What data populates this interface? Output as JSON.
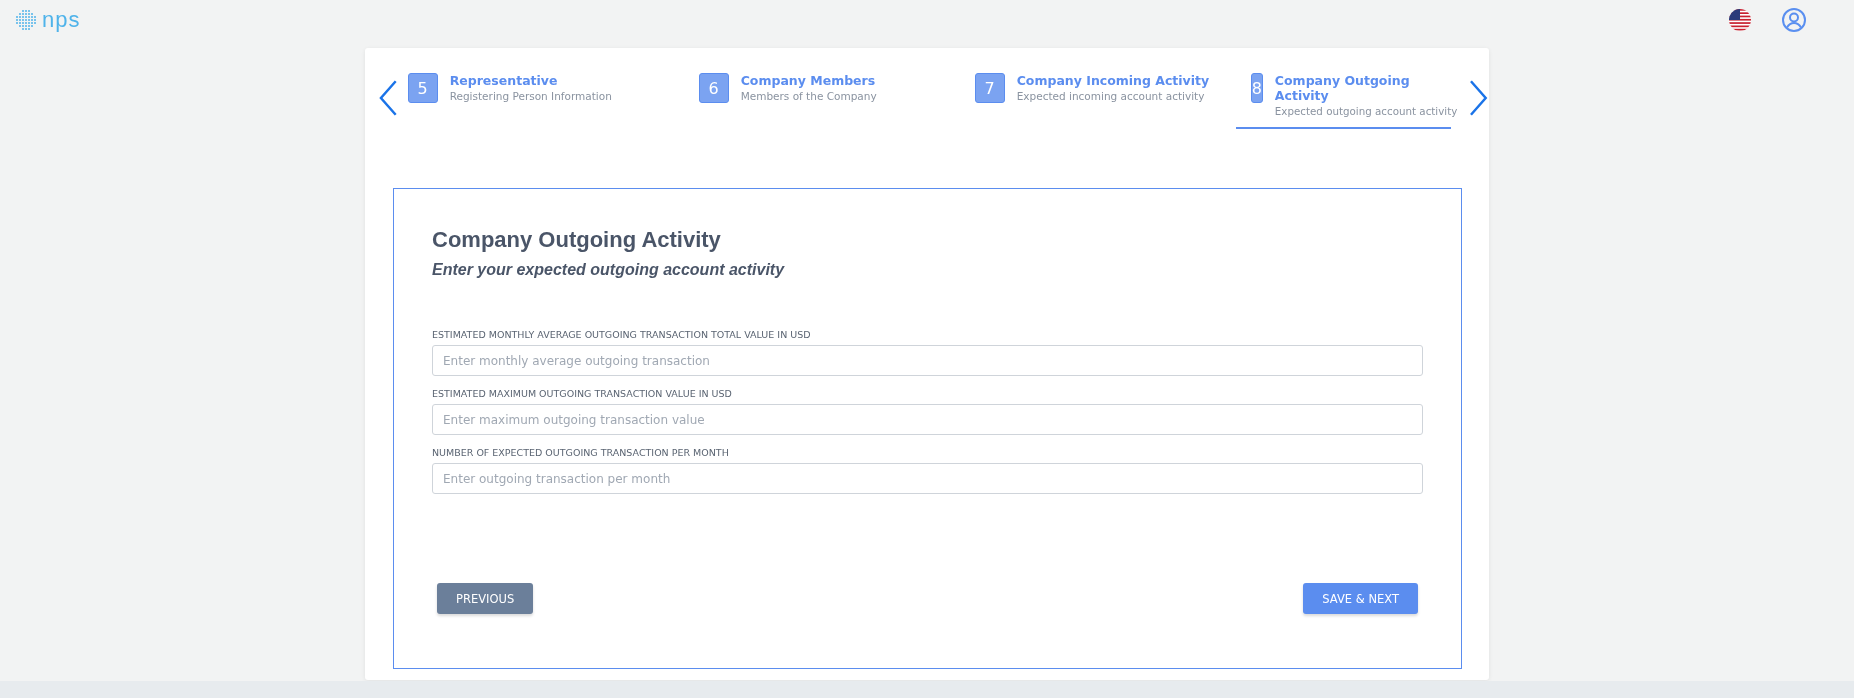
{
  "header": {
    "logo_text": "nps"
  },
  "steps": [
    {
      "number": "5",
      "title": "Representative",
      "subtitle": "Registering Person Information",
      "selected": false
    },
    {
      "number": "6",
      "title": "Company Members",
      "subtitle": "Members of the Company",
      "selected": false
    },
    {
      "number": "7",
      "title": "Company Incoming Activity",
      "subtitle": "Expected incoming account activity",
      "selected": false
    },
    {
      "number": "8",
      "title": "Company Outgoing Activity",
      "subtitle": "Expected outgoing account activity",
      "selected": true
    }
  ],
  "form": {
    "title": "Company Outgoing Activity",
    "subtitle": "Enter your expected outgoing account activity",
    "fields": [
      {
        "label": "ESTIMATED MONTHLY AVERAGE OUTGOING TRANSACTION TOTAL VALUE IN USD",
        "placeholder": "Enter monthly average outgoing transaction"
      },
      {
        "label": "ESTIMATED MAXIMUM OUTGOING TRANSACTION VALUE IN USD",
        "placeholder": "Enter maximum outgoing transaction value"
      },
      {
        "label": "NUMBER OF EXPECTED OUTGOING TRANSACTION PER MONTH",
        "placeholder": "Enter outgoing transaction per month"
      }
    ],
    "buttons": [
      {
        "label": "PREVIOUS",
        "kind": "secondary"
      },
      {
        "label": "SAVE & NEXT",
        "kind": "primary"
      }
    ]
  }
}
